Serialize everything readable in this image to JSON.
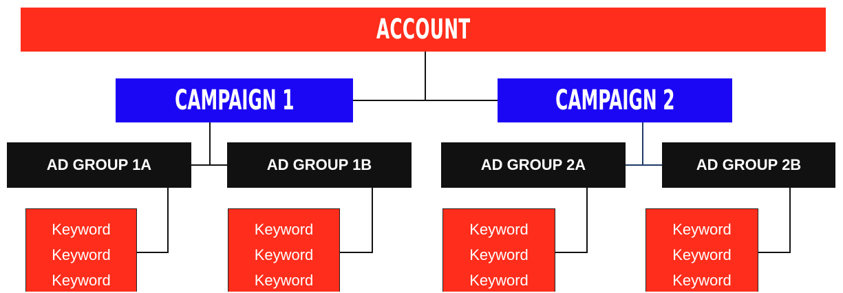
{
  "account": {
    "label": "ACCOUNT",
    "color": "#ff2d1b"
  },
  "campaigns": [
    {
      "label": "CAMPAIGN 1",
      "color": "#1c07f5"
    },
    {
      "label": "CAMPAIGN 2",
      "color": "#1c07f5"
    }
  ],
  "ad_groups": [
    {
      "label": "AD GROUP 1A"
    },
    {
      "label": "AD GROUP 1B"
    },
    {
      "label": "AD GROUP 2A"
    },
    {
      "label": "AD GROUP 2B"
    }
  ],
  "keyword_lists": [
    {
      "keywords": [
        "Keyword",
        "Keyword",
        "Keyword"
      ]
    },
    {
      "keywords": [
        "Keyword",
        "Keyword",
        "Keyword"
      ]
    },
    {
      "keywords": [
        "Keyword",
        "Keyword",
        "Keyword"
      ]
    },
    {
      "keywords": [
        "Keyword",
        "Keyword",
        "Keyword"
      ]
    }
  ]
}
